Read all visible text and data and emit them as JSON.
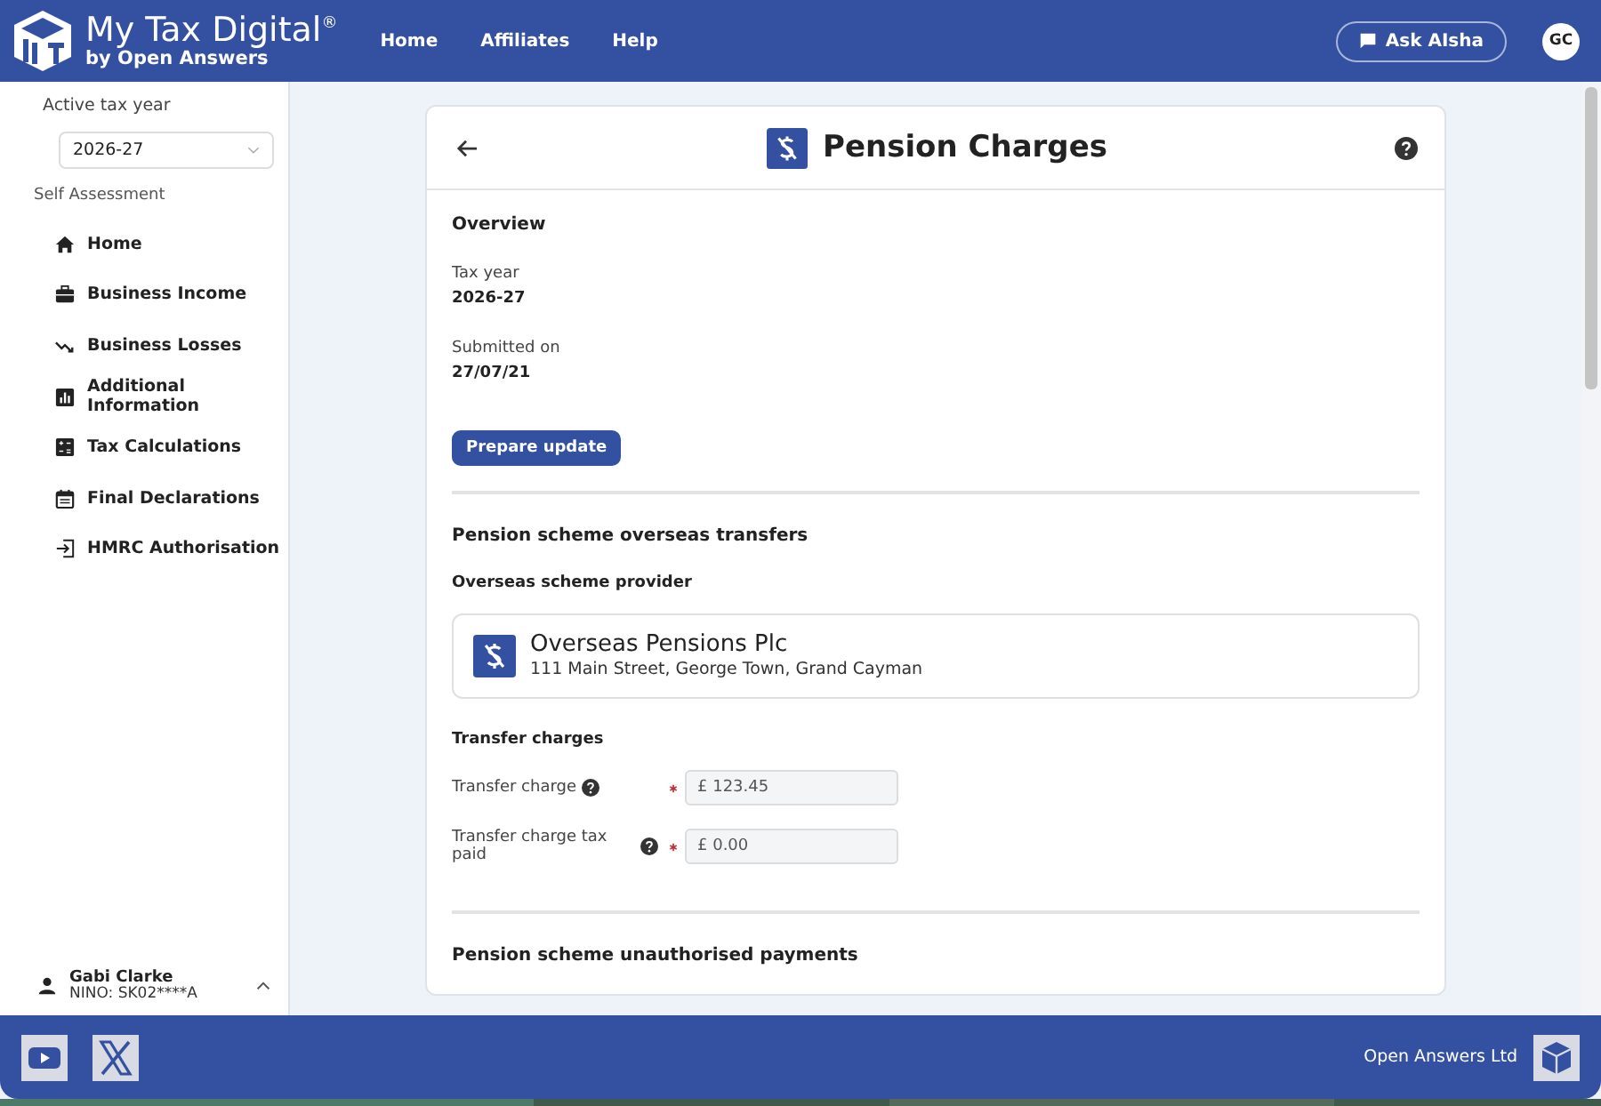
{
  "header": {
    "brand": "My Tax Digital",
    "brand_mark": "®",
    "byline": "by Open Answers",
    "nav": [
      {
        "label": "Home"
      },
      {
        "label": "Affiliates"
      },
      {
        "label": "Help"
      }
    ],
    "assistant_button": "Ask AIsha",
    "avatar": "GC"
  },
  "sidebar": {
    "tax_year_label": "Active tax year",
    "tax_year": "2026-27",
    "section": "Self Assessment",
    "items": [
      {
        "label": "Home"
      },
      {
        "label": "Business Income"
      },
      {
        "label": "Business Losses"
      },
      {
        "label": "Additional Information"
      },
      {
        "label": "Tax Calculations"
      },
      {
        "label": "Final Declarations"
      },
      {
        "label": "HMRC Authorisation"
      }
    ],
    "user": {
      "name": "Gabi Clarke",
      "nino": "NINO: SK02****A",
      "expanded": true
    }
  },
  "page": {
    "title": "Pension Charges",
    "overview": {
      "heading": "Overview",
      "facts": [
        {
          "label": "Tax year",
          "value": "2026-27"
        },
        {
          "label": "Submitted on",
          "value": "27/07/21"
        }
      ],
      "button": "Prepare update"
    },
    "transfers": {
      "heading": "Pension scheme overseas transfers",
      "provider_heading": "Overseas scheme provider",
      "provider": {
        "name": "Overseas Pensions Plc",
        "address": "111 Main Street, George Town, Grand Cayman"
      },
      "charges_heading": "Transfer charges",
      "fields": [
        {
          "label": "Transfer charge",
          "help": true,
          "required": true,
          "value": "£ 123.45"
        },
        {
          "label": "Transfer charge tax paid",
          "help": true,
          "required": true,
          "value": "£ 0.00"
        }
      ]
    },
    "next_heading": "Pension scheme unauthorised payments"
  },
  "footer": {
    "company": "Open Answers Ltd"
  }
}
